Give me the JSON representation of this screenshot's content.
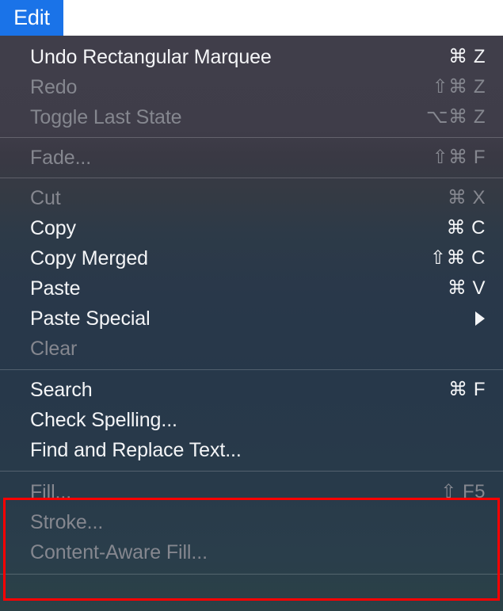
{
  "menubar": {
    "active_menu": "Edit"
  },
  "menu": {
    "title": "Edit",
    "groups": [
      {
        "id": "group-undo",
        "items": [
          {
            "label": "Undo Rectangular Marquee",
            "shortcut": "⌘ Z",
            "enabled": true,
            "submenu": false
          },
          {
            "label": "Redo",
            "shortcut": "⇧⌘ Z",
            "enabled": false,
            "submenu": false
          },
          {
            "label": "Toggle Last State",
            "shortcut": "⌥⌘ Z",
            "enabled": false,
            "submenu": false
          }
        ]
      },
      {
        "id": "group-fade",
        "items": [
          {
            "label": "Fade...",
            "shortcut": "⇧⌘ F",
            "enabled": false,
            "submenu": false
          }
        ]
      },
      {
        "id": "group-clipboard",
        "items": [
          {
            "label": "Cut",
            "shortcut": "⌘ X",
            "enabled": false,
            "submenu": false
          },
          {
            "label": "Copy",
            "shortcut": "⌘ C",
            "enabled": true,
            "submenu": false
          },
          {
            "label": "Copy Merged",
            "shortcut": "⇧⌘ C",
            "enabled": true,
            "submenu": false
          },
          {
            "label": "Paste",
            "shortcut": "⌘ V",
            "enabled": true,
            "submenu": false
          },
          {
            "label": "Paste Special",
            "shortcut": "",
            "enabled": true,
            "submenu": true
          },
          {
            "label": "Clear",
            "shortcut": "",
            "enabled": false,
            "submenu": false
          }
        ]
      },
      {
        "id": "group-find",
        "items": [
          {
            "label": "Search",
            "shortcut": "⌘ F",
            "enabled": true,
            "submenu": false
          },
          {
            "label": "Check Spelling...",
            "shortcut": "",
            "enabled": true,
            "submenu": false
          },
          {
            "label": "Find and Replace Text...",
            "shortcut": "",
            "enabled": true,
            "submenu": false
          }
        ]
      },
      {
        "id": "group-fill",
        "items": [
          {
            "label": "Fill...",
            "shortcut": "⇧ F5",
            "enabled": false,
            "submenu": false
          },
          {
            "label": "Stroke...",
            "shortcut": "",
            "enabled": false,
            "submenu": false
          },
          {
            "label": "Content-Aware Fill...",
            "shortcut": "",
            "enabled": false,
            "submenu": false
          }
        ]
      }
    ]
  },
  "annotation": {
    "highlight_color": "#ff0000",
    "highlight_target": "Fill / Stroke / Content-Aware Fill group"
  },
  "colors": {
    "menubar_active_bg": "#1a73e8",
    "menubar_active_text": "#ffffff",
    "menu_bg_top": "#403e4a",
    "menu_bg_bottom": "#2b4146",
    "text_enabled": "#f4f5f7",
    "text_disabled": "#85878f",
    "separator": "rgba(255,255,255,0.20)"
  }
}
